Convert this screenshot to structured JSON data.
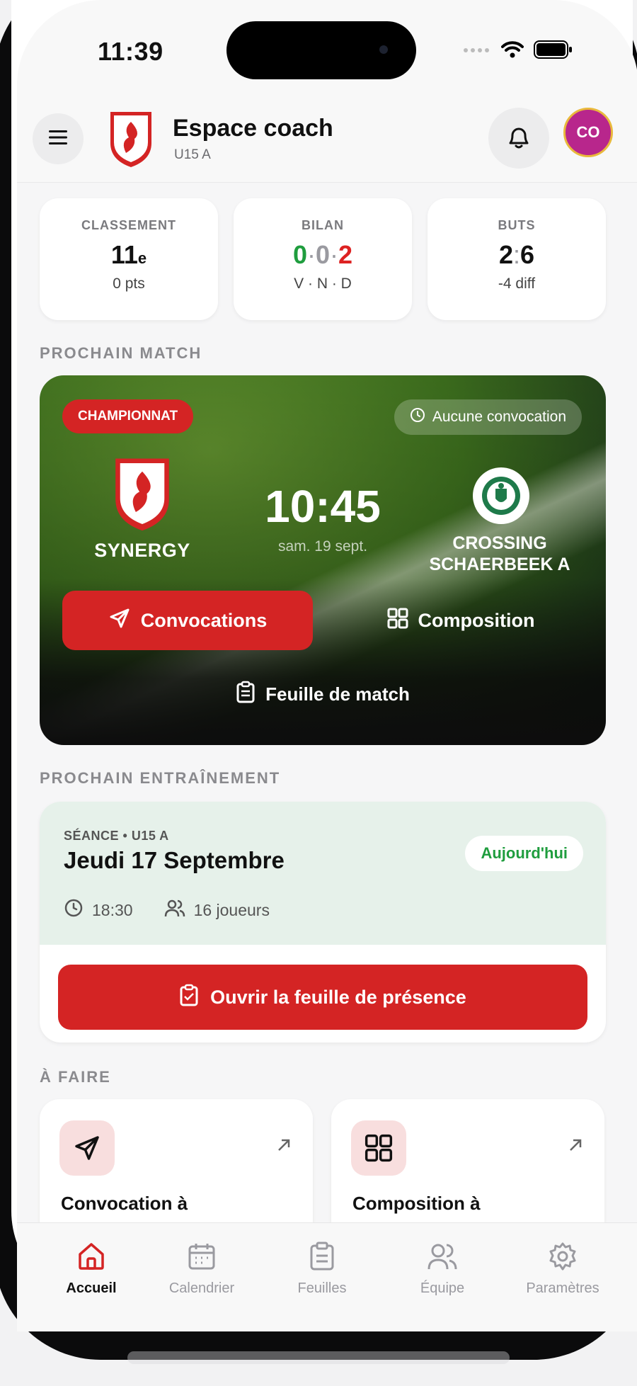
{
  "status": {
    "time": "11:39"
  },
  "header": {
    "title": "Espace coach",
    "subtitle": "U15 A",
    "avatar_initials": "CO"
  },
  "stats": {
    "classement": {
      "label": "CLASSEMENT",
      "rank": "11",
      "suffix": "e",
      "sub": "0 pts"
    },
    "bilan": {
      "label": "BILAN",
      "v": "0",
      "n": "0",
      "d": "2",
      "sep": "·",
      "sub": "V · N · D"
    },
    "buts": {
      "label": "BUTS",
      "for": "2",
      "sep": ":",
      "against": "6",
      "sub": "-4 diff"
    }
  },
  "next_match": {
    "section": "PROCHAIN MATCH",
    "competition": "CHAMPIONNAT",
    "convocation_status": "Aucune convocation",
    "home_team": "SYNERGY",
    "away_team": "CROSSING SCHAERBEEK A",
    "kickoff": "10:45",
    "date": "sam. 19 sept.",
    "btn_convocations": "Convocations",
    "btn_composition": "Composition",
    "btn_feuille": "Feuille de match"
  },
  "next_training": {
    "section": "PROCHAIN ENTRAÎNEMENT",
    "meta": "SÉANCE • U15 A",
    "title": "Jeudi 17 Septembre",
    "badge": "Aujourd'hui",
    "time": "18:30",
    "players": "16 joueurs",
    "btn_presence": "Ouvrir la feuille de présence"
  },
  "todo": {
    "section": "À FAIRE",
    "items": [
      {
        "title": "Convocation à",
        "icon": "send-icon"
      },
      {
        "title": "Composition à",
        "icon": "grid-icon"
      }
    ]
  },
  "tabbar": {
    "items": [
      {
        "label": "Accueil",
        "icon": "home-icon",
        "active": true
      },
      {
        "label": "Calendrier",
        "icon": "calendar-icon"
      },
      {
        "label": "Feuilles",
        "icon": "clipboard-icon"
      },
      {
        "label": "Équipe",
        "icon": "users-icon"
      },
      {
        "label": "Paramètres",
        "icon": "settings-icon"
      }
    ]
  },
  "colors": {
    "accent": "#d42424",
    "success": "#1f9d3e",
    "avatar": "#b8268c"
  }
}
